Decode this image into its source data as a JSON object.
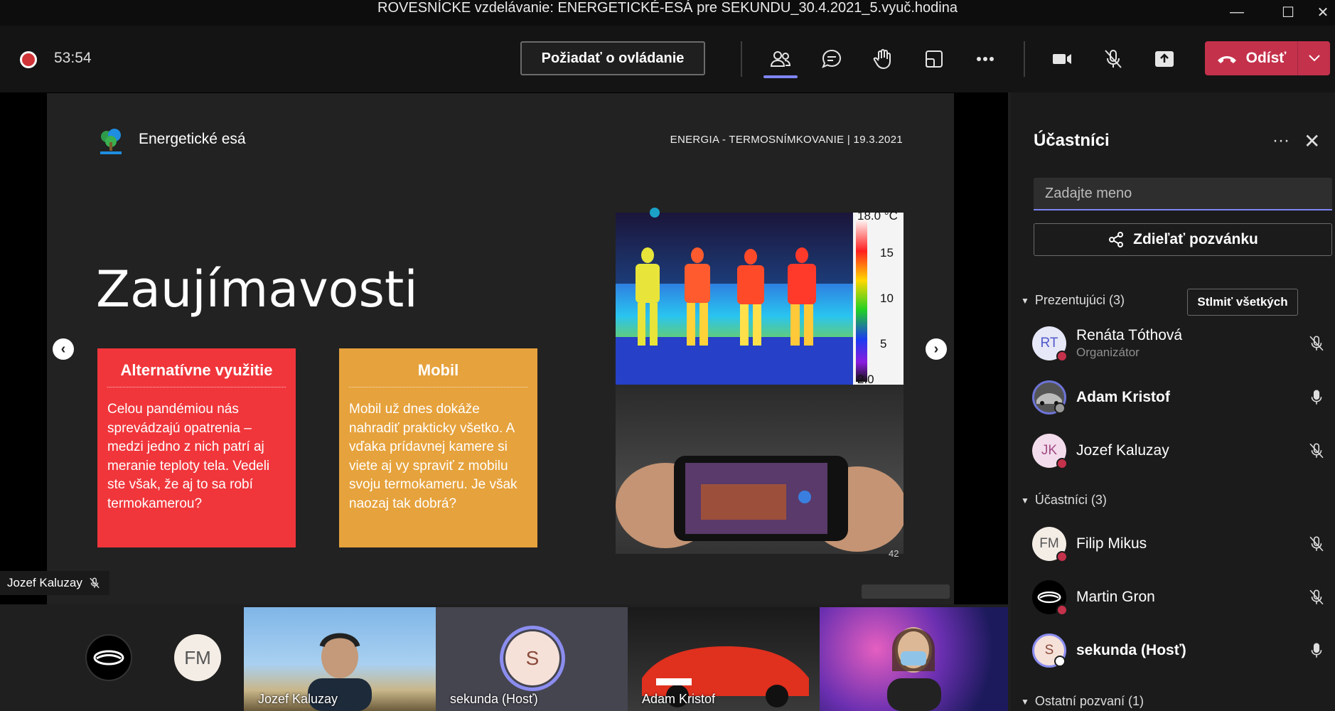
{
  "window": {
    "title": "ROVESNÍCKE vzdelávanie: ENERGETICKÉ-ESÁ pre SEKUNDU_30.4.2021_5.vyuč.hodina"
  },
  "toolbar": {
    "timer": "53:54",
    "request_control": "Požiadať o ovládanie",
    "leave_label": "Odísť",
    "icons": [
      "people-icon",
      "chat-icon",
      "raise-hand-icon",
      "rooms-icon",
      "more-icon",
      "camera-icon",
      "mic-off-icon",
      "share-icon"
    ]
  },
  "slide": {
    "brand": "Energetické esá",
    "meta": "ENERGIA - TERMOSNÍMKOVANIE | 19.3.2021",
    "title": "Zaujímavosti",
    "cards": [
      {
        "title": "Alternatívne využitie",
        "text": "Celou pandémiou nás sprevádzajú opatrenia – medzi jedno z nich patrí aj meranie teploty tela. Vedeli ste však, že aj to sa robí termokamerou?",
        "color": "#f0363b"
      },
      {
        "title": "Mobil",
        "text": "Mobil už dnes dokáže nahradiť prakticky všetko. A vďaka prídavnej kamere si viete aj vy spraviť z mobilu svoju termokameru. Je však naozaj tak dobrá?",
        "color": "#e6a23c"
      }
    ],
    "thermal_scale": {
      "top": "18.0 °C",
      "t15": "15",
      "t10": "10",
      "t5": "5",
      "bottom": "2.0"
    },
    "page_number": "42",
    "prev": "‹",
    "next": "›"
  },
  "presenter_chip": {
    "name": "Jozef Kaluzay"
  },
  "gallery": {
    "avatar2": "FM",
    "tiles": [
      {
        "label": "Jozef Kaluzay"
      },
      {
        "label": "sekunda (Hosť)",
        "initial": "S"
      },
      {
        "label": "Adam Kristof"
      },
      {
        "label": ""
      }
    ]
  },
  "panel": {
    "title": "Účastníci",
    "search_placeholder": "Zadajte meno",
    "share_invite": "Zdieľať pozvánku",
    "presenters_header": "Prezentujúci (3)",
    "mute_all": "Stlmiť všetkých",
    "attendees_header": "Účastníci (3)",
    "others_header": "Ostatní pozvaní (1)",
    "presenters": [
      {
        "initials": "RT",
        "name": "Renáta Tóthová",
        "role": "Organizátor",
        "avatar_color": "#e6e7f7",
        "mic": "off"
      },
      {
        "initials": "",
        "name": "Adam Kristof",
        "role": "",
        "avatar_color": "#555555",
        "mic": "on"
      },
      {
        "initials": "JK",
        "name": "Jozef Kaluzay",
        "role": "",
        "avatar_color": "#f3dcec",
        "mic": "off"
      }
    ],
    "attendees": [
      {
        "initials": "FM",
        "name": "Filip Mikus",
        "avatar_color": "#f4ede6",
        "mic": "off"
      },
      {
        "initials": "",
        "name": "Martin Gron",
        "avatar_color": "#000000",
        "mic": "off"
      },
      {
        "initials": "S",
        "name": "sekunda (Hosť)",
        "avatar_color": "#f6e1d9",
        "mic": "on"
      }
    ]
  }
}
